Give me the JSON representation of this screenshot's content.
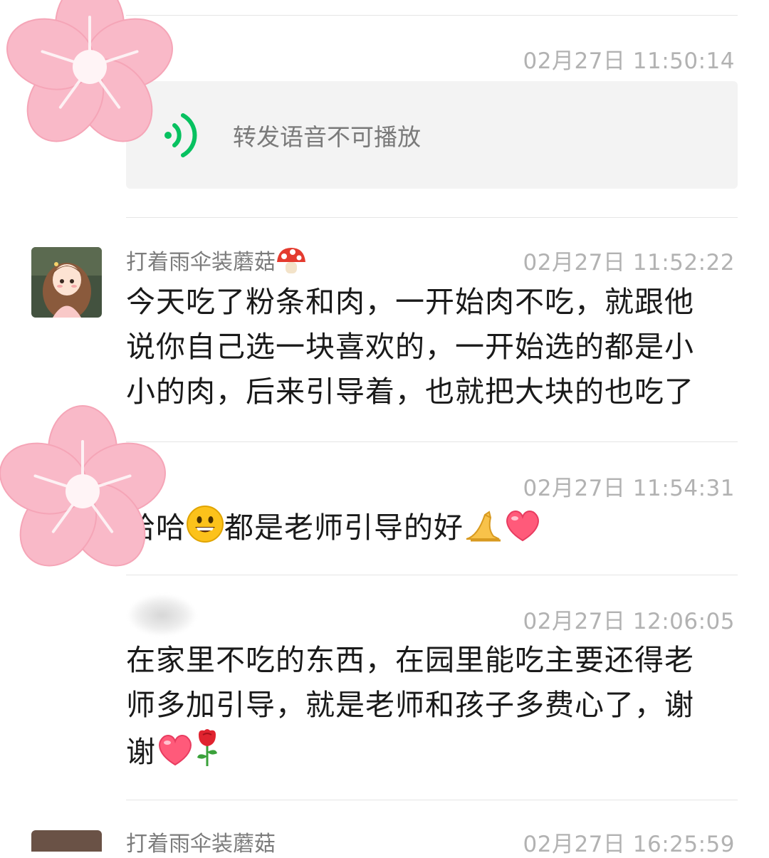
{
  "messages": [
    {
      "time": "02月27日 11:50:14",
      "voice_label": "转发语音不可播放"
    },
    {
      "sender": "打着雨伞装蘑菇",
      "sender_emoji": "mushroom-emoji",
      "time": "02月27日 11:52:22",
      "lines": [
        "今天吃了粉条和肉，一开始肉不吃，就跟他",
        "说你自己选一块喜欢的，一开始选的都是小",
        "小的肉，后来引导着，也就把大块的也吃了"
      ]
    },
    {
      "time": "02月27日 11:54:31",
      "text_a": "哈哈",
      "text_b": "都是老师引导的好",
      "emojis": [
        "grinning-face-emoji",
        "folded-hands-emoji",
        "red-heart-emoji"
      ]
    },
    {
      "time": "02月27日 12:06:05",
      "lines": [
        "在家里不吃的东西，在园里能吃主要还得老",
        "师多加引导，就是老师和孩子多费心了，谢",
        "谢"
      ],
      "emojis": [
        "red-heart-emoji",
        "rose-emoji"
      ]
    },
    {
      "sender": "打着雨伞装蘑菇",
      "time": "02月27日 16:25:59"
    }
  ],
  "colors": {
    "voice_green": "#07c160",
    "heart": "#ff5a7a",
    "flower": "#f9b9c8"
  }
}
